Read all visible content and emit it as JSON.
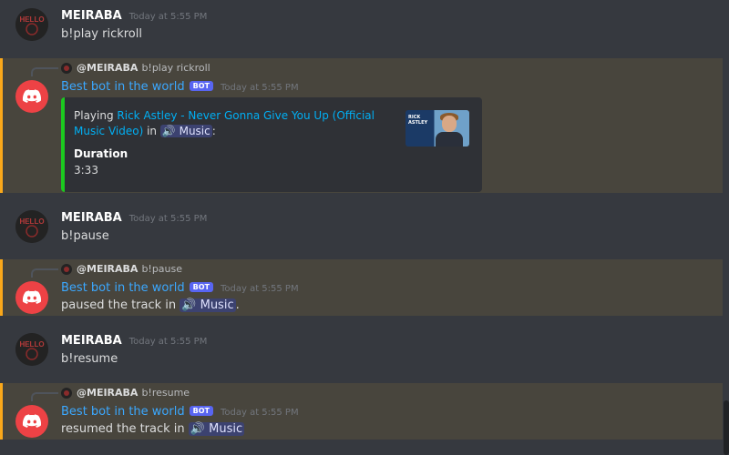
{
  "colors": {
    "mention_bar": "#faa81a",
    "embed_bar": "#1cc920",
    "bot_name": "#3ba8ff",
    "bot_avatar": "#ed4245"
  },
  "messages": {
    "m1": {
      "author": "MEIRABA",
      "time": "Today at 5:55 PM",
      "text": "b!play rickroll"
    },
    "r1": {
      "reply_author": "@MEIRABA",
      "reply_text": "b!play rickroll",
      "author": "Best bot in the world",
      "badge": "BOT",
      "time": "Today at 5:55 PM",
      "embed": {
        "prefix": "Playing ",
        "link": "Rick Astley - Never Gonna Give You Up (Official Music Video)",
        "in": " in ",
        "channel": "🔊 Music",
        "suffix": ":",
        "field_name": "Duration",
        "field_value": "3:33",
        "thumb_text": "RICK ASTLEY"
      }
    },
    "m2": {
      "author": "MEIRABA",
      "time": "Today at 5:55 PM",
      "text": "b!pause"
    },
    "r2": {
      "reply_author": "@MEIRABA",
      "reply_text": "b!pause",
      "author": "Best bot in the world",
      "badge": "BOT",
      "time": "Today at 5:55 PM",
      "text_before": "paused the track in ",
      "channel": "🔊 Music",
      "text_after": "."
    },
    "m3": {
      "author": "MEIRABA",
      "time": "Today at 5:55 PM",
      "text": "b!resume"
    },
    "r3": {
      "reply_author": "@MEIRABA",
      "reply_text": "b!resume",
      "author": "Best bot in the world",
      "badge": "BOT",
      "time": "Today at 5:55 PM",
      "text_before": "resumed the track in ",
      "channel": "🔊 Music",
      "text_after": ""
    }
  }
}
